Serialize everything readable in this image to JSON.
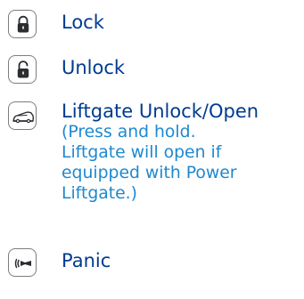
{
  "items": [
    {
      "label": "Lock",
      "icon": "lock-closed-icon"
    },
    {
      "label": "Unlock",
      "icon": "lock-open-icon"
    },
    {
      "label": "Liftgate Unlock/Open",
      "icon": "liftgate-vehicle-icon",
      "description_lines": [
        "(Press and hold.",
        "Liftgate will open if",
        "equipped with Power",
        "Liftgate.)"
      ]
    },
    {
      "label": "Panic",
      "icon": "horn-panic-icon"
    }
  ],
  "colors": {
    "label": "#003b8f",
    "description": "#1e88cf",
    "icon_stroke": "#7a7d82",
    "icon_fill": "#2b2d31"
  }
}
